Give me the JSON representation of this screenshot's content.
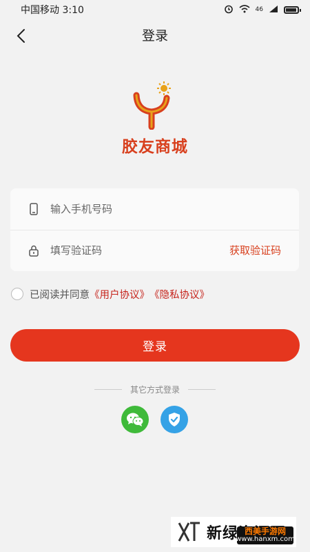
{
  "status_bar": {
    "carrier_time": "中国移动 3:10",
    "network": "46",
    "icons": [
      "alarm-icon",
      "wifi-icon",
      "signal-icon",
      "battery-icon"
    ]
  },
  "nav": {
    "title": "登录",
    "back_icon": "chevron-left-icon"
  },
  "brand": {
    "name": "胶友商城",
    "logo_letter": "Y",
    "color": "#d8401e"
  },
  "form": {
    "phone_placeholder": "输入手机号码",
    "code_placeholder": "填写验证码",
    "get_code_label": "获取验证码"
  },
  "agreement": {
    "text": "已阅读并同意",
    "user_agreement": "《用户协议》",
    "privacy_policy": "《隐私协议》",
    "checked": false
  },
  "login_button": {
    "label": "登录",
    "color": "#e5361e"
  },
  "other_login": {
    "label": "其它方式登录",
    "options": [
      "wechat-icon",
      "shield-check-icon"
    ]
  },
  "watermark": {
    "title": "新绿资源网",
    "badge_line1": "西美手游网",
    "badge_line2": "www.hanxm.com"
  }
}
